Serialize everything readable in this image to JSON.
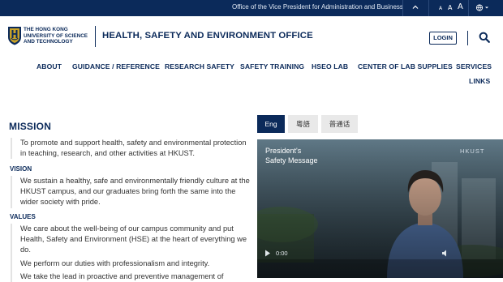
{
  "topbar": {
    "office_link": "Office of the Vice President for Administration and Business",
    "font_size_small": "A",
    "font_size_medium": "A",
    "font_size_large": "A",
    "chevron_icon": "chevron-up-icon",
    "language_icon": "globe-icon"
  },
  "header": {
    "university_line1": "THE HONG KONG",
    "university_line2": "UNIVERSITY OF SCIENCE",
    "university_line3": "AND TECHNOLOGY",
    "site_title": "HEALTH, SAFETY AND ENVIRONMENT OFFICE",
    "login_label": "LOGIN",
    "search_icon": "search-icon"
  },
  "nav": {
    "items": [
      {
        "label": "ABOUT"
      },
      {
        "label": "GUIDANCE / REFERENCE"
      },
      {
        "label": "RESEARCH SAFETY"
      },
      {
        "label": "SAFETY TRAINING"
      },
      {
        "label": "HSEO LAB"
      },
      {
        "label": "CENTER OF LAB SUPPLIES"
      },
      {
        "label": "SERVICES"
      },
      {
        "label": "LINKS"
      }
    ]
  },
  "content": {
    "mission_heading": "MISSION",
    "mission_text": "To promote and support health, safety and environmental protection in teaching, research, and other activities at HKUST.",
    "vision_heading": "VISION",
    "vision_text": "We sustain a healthy, safe and environmentally friendly culture at the HKUST campus, and our graduates bring forth the same into the wider society with pride.",
    "values_heading": "VALUES",
    "values_text_1": "We care about the well-being of our campus community and put Health, Safety and Environment (HSE) at the heart of everything we do.",
    "values_text_2": "We perform our duties with professionalism and integrity.",
    "values_text_3": "We take the lead in proactive and preventive management of"
  },
  "video_tabs": {
    "tabs": [
      {
        "label": "Eng",
        "active": true
      },
      {
        "label": "粵語",
        "active": false
      },
      {
        "label": "普通话",
        "active": false
      }
    ]
  },
  "video": {
    "caption_line1": "President's",
    "caption_line2": "Safety Message",
    "brand": "HKUST",
    "time": "0:00"
  },
  "colors": {
    "brand_navy": "#0b2a5a",
    "text_gray": "#333333",
    "tab_inactive": "#e9e9e9",
    "logo_gold": "#c9a227"
  }
}
